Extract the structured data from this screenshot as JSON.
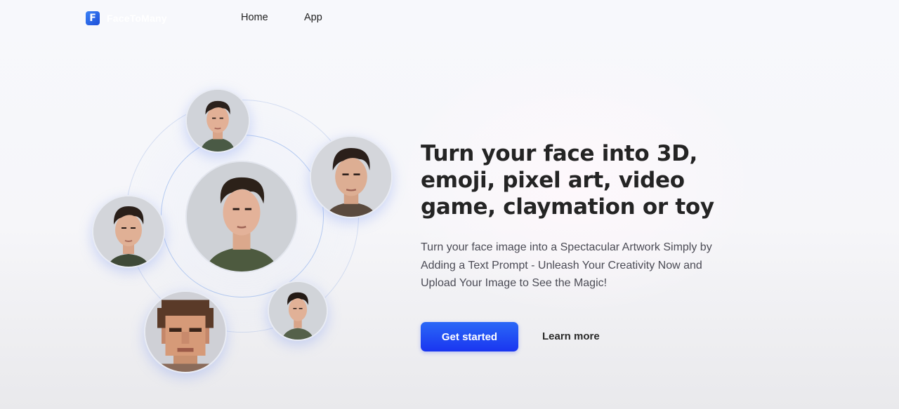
{
  "header": {
    "logo_text": "FaceToMany",
    "nav": [
      {
        "label": "Home"
      },
      {
        "label": "App"
      }
    ]
  },
  "hero": {
    "title": "Turn your face into 3D, emoji, pixel art, video game, claymation or toy",
    "description": "Turn your face image into a Spectacular Artwork Simply by Adding a Text Prompt - Unleash Your Creativity Now and Upload Your Image to See the Magic!",
    "primary_button": "Get started",
    "secondary_link": "Learn more"
  },
  "colors": {
    "accent": "#1f4cf5",
    "title": "#242424",
    "body_text": "#4b4b55"
  },
  "icons": {
    "logo": "facetomany-logo-icon"
  }
}
